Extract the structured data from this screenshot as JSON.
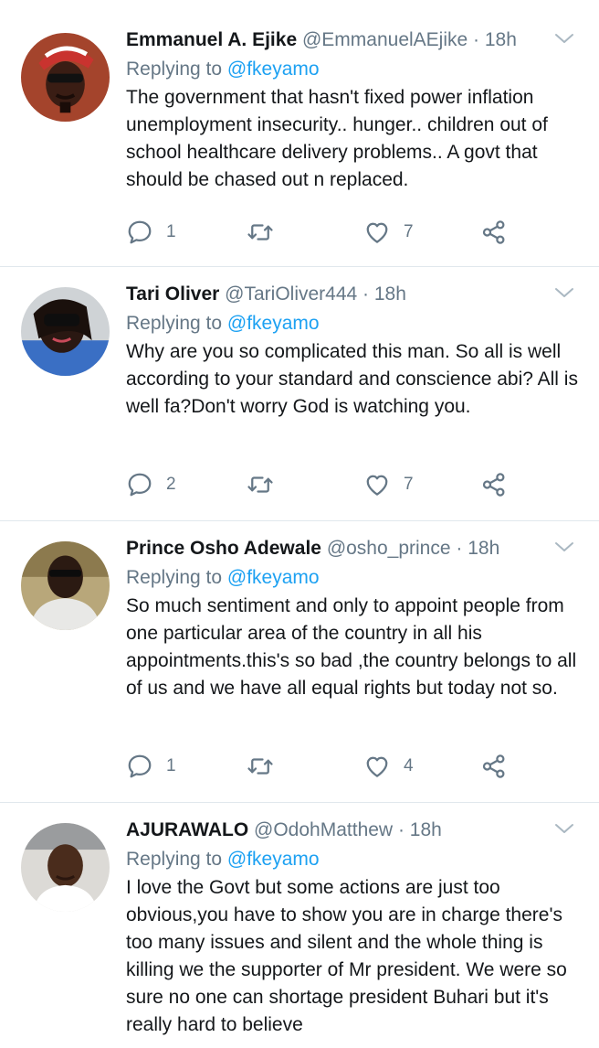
{
  "tweets": [
    {
      "name": "Emmanuel A. Ejike",
      "handle": "@EmmanuelAEjike",
      "time": "· 18h",
      "replying_label": "Replying to",
      "replying_to": "@fkeyamo",
      "text": "The government that hasn't fixed power inflation unemployment insecurity.. hunger.. children out of school healthcare delivery problems.. A govt that should be chased out n replaced.",
      "replies": "1",
      "retweets": "",
      "likes": "7"
    },
    {
      "name": "Tari Oliver",
      "handle": "@TariOliver444",
      "time": "· 18h",
      "replying_label": "Replying to",
      "replying_to": "@fkeyamo",
      "text": "Why are you so complicated this man. So all is well according to your standard and conscience abi? All is well fa?Don't worry God is watching you.",
      "replies": "2",
      "retweets": "",
      "likes": "7"
    },
    {
      "name": "Prince Osho Adewale",
      "handle": "@osho_prince",
      "time": "· 18h",
      "replying_label": "Replying to",
      "replying_to": "@fkeyamo",
      "text": "So much sentiment and only to appoint people from one particular area of the country in all his appointments.this's so bad ,the country belongs to all of us and we have all equal rights but today not so.",
      "replies": "1",
      "retweets": "",
      "likes": "4"
    },
    {
      "name": "AJURAWALO",
      "handle": "@OdohMatthew",
      "time": "· 18h",
      "replying_label": "Replying to",
      "replying_to": "@fkeyamo",
      "text": "I love the Govt but some actions are just too obvious,you have to show you are in charge there's too many issues and silent and the whole thing is killing we the supporter of Mr president. We were so sure no one can shortage president Buhari but it's really hard to believe"
    }
  ],
  "icons": {
    "reply": "reply-icon",
    "retweet": "retweet-icon",
    "like": "heart-icon",
    "share": "share-icon",
    "menu": "chevron-down-icon"
  },
  "colors": {
    "text": "#14171a",
    "secondary": "#657786",
    "link": "#1da1f2",
    "divider": "#e1e8ed"
  }
}
